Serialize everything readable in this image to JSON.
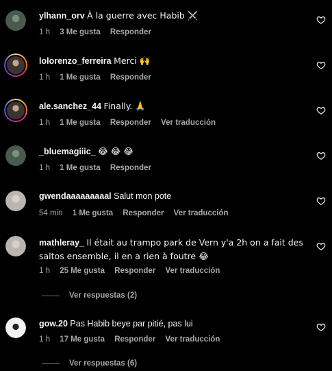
{
  "comments": [
    {
      "username": "ylhann_orv",
      "text": "À la guerre avec Habib ⚔️",
      "time": "1 h",
      "likes": "3 Me gusta",
      "reply": "Responder",
      "translate": ""
    },
    {
      "username": "lolorenzo_ferreira",
      "text": "Merci 🙌",
      "time": "1 h",
      "likes": "1 Me gusta",
      "reply": "Responder",
      "translate": ""
    },
    {
      "username": "ale.sanchez_44",
      "text": "Finally. 🙏",
      "time": "1 h",
      "likes": "1 Me gusta",
      "reply": "Responder",
      "translate": "Ver traducción"
    },
    {
      "username": "_bluemagiiic_",
      "text": "😂 😂 😂",
      "time": "1 h",
      "likes": "1 Me gusta",
      "reply": "Responder",
      "translate": ""
    },
    {
      "username": "gwendaaaaaaaaal",
      "text": "Salut mon pote",
      "time": "54 min",
      "likes": "1 Me gusta",
      "reply": "Responder",
      "translate": "Ver traducción"
    },
    {
      "username": "mathleray_",
      "text": "Il était au trampo park de Vern y'a 2h on a fait des saltos ensemble, il en a rien à foutre 😂",
      "time": "1 h",
      "likes": "25 Me gusta",
      "reply": "Responder",
      "translate": "Ver traducción",
      "replies": "Ver respuestas (2)"
    },
    {
      "username": "gow.20",
      "text": "Pas Habib beye par pitié, pas lui",
      "time": "1 h",
      "likes": "17 Me gusta",
      "reply": "Responder",
      "translate": "Ver traducción",
      "replies": "Ver respuestas (6)"
    }
  ],
  "icons": {
    "like": "heart-outline-icon"
  },
  "colors": {
    "background": "#000000",
    "primary_text": "#f5f5f5",
    "secondary_text": "#a8a8a8"
  }
}
